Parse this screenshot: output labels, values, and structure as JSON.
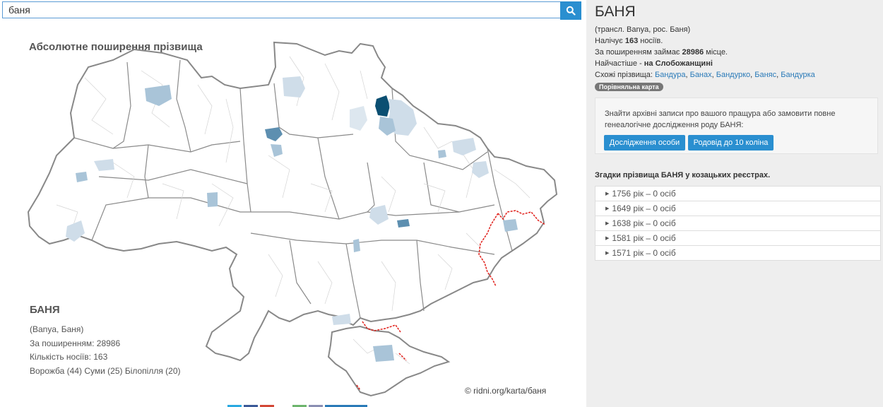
{
  "search": {
    "value": "баня"
  },
  "map": {
    "title": "Абсолютне поширення прізвища",
    "legend": {
      "name": "БАНЯ",
      "variants": "(Banya, Баня)",
      "rank_line": "За поширенням: 28986",
      "count_line": "Кількість носіїв:  163",
      "top_places": "Ворожба (44) Суми (25) Білопілля (20)"
    },
    "copyright": "© ridni.org/karta/баня",
    "colors": {
      "border": "#888888",
      "frontline": "#e0201b",
      "dark": "#0b4f72",
      "mid": "#5d8fb0",
      "light": "#a9c4d8",
      "pale": "#cfdde9"
    }
  },
  "info": {
    "title": "БАНЯ",
    "translit": "(трансл. Banya, рос. Баня)",
    "carriers_prefix": "Налічує ",
    "carriers_count": "163",
    "carriers_suffix": " носіїв.",
    "rank_prefix": "За поширенням займає ",
    "rank_value": "28986",
    "rank_suffix": " місце.",
    "region_prefix": "Найчастіше - ",
    "region_value": "на Слобожанщині",
    "similar_label": "Схожі прізвища: ",
    "similar": [
      "Бандура",
      "Банах",
      "Бандурко",
      "Баняс",
      "Бандурка"
    ],
    "compare_badge": "Порівняльна карта"
  },
  "archive": {
    "text": "Знайти архівні записи про вашого пращура або замовити повне генеалогічне дослідження роду БАНЯ:",
    "btn_person": "Дослідження особи",
    "btn_lineage": "Родовід до 10 коліна"
  },
  "registry": {
    "title": "Згадки прізвища БАНЯ у козацьких реєстрах.",
    "rows": [
      "1756 рік – 0 осіб",
      "1649 рік – 0 осіб",
      "1638 рік – 0 осіб",
      "1581 рік – 0 осіб",
      "1571 рік – 0 осіб"
    ]
  }
}
